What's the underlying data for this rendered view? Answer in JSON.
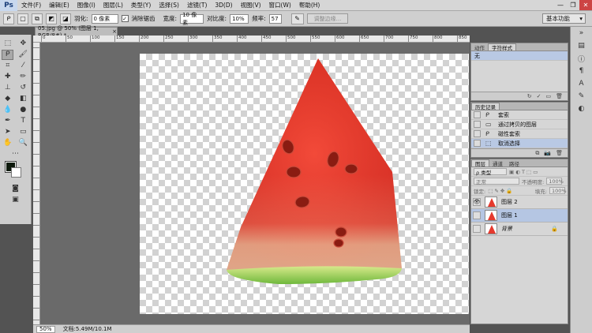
{
  "app": {
    "logo": "Ps"
  },
  "menu": [
    "文件(F)",
    "编辑(E)",
    "图像(I)",
    "图层(L)",
    "类型(Y)",
    "选择(S)",
    "滤镜(T)",
    "3D(D)",
    "视图(V)",
    "窗口(W)",
    "帮助(H)"
  ],
  "window_controls": {
    "minimize": "—",
    "restore": "❐",
    "close": "✕"
  },
  "options": {
    "feather_label": "羽化:",
    "feather_value": "0 像素",
    "antialias_label": "消除锯齿",
    "antialias_checked": "✓",
    "width_label": "宽度:",
    "width_value": "10 像素",
    "contrast_label": "对比度:",
    "contrast_value": "10%",
    "frequency_label": "频率:",
    "frequency_value": "57",
    "refine_label": "调整边缘...",
    "workspace": "基本功能"
  },
  "document": {
    "tab_title": "05.jpg @ 50% (图层 1, RGB/8#) *",
    "close": "×"
  },
  "ruler": {
    "top_ticks": [
      "0",
      "50",
      "100",
      "150",
      "200",
      "250",
      "300",
      "350",
      "400",
      "450",
      "500",
      "550",
      "600",
      "650",
      "700",
      "750",
      "800",
      "850"
    ]
  },
  "status": {
    "zoom": "50%",
    "doc_info": "文档:5.49M/10.1M"
  },
  "colors": {
    "foreground": "#0e1a0d",
    "background": "#ffffff",
    "selection": "#b5c6e3"
  },
  "actions_panel": {
    "tabs": [
      "动作",
      "字符样式"
    ],
    "active_item": "无"
  },
  "history_panel": {
    "title": "历史记录",
    "items": [
      {
        "label": "套索",
        "icon": "lasso-icon"
      },
      {
        "label": "通过拷贝的图层",
        "icon": "layer-icon"
      },
      {
        "label": "磁性套索",
        "icon": "magnetic-lasso-icon"
      },
      {
        "label": "取消选择",
        "icon": "deselect-icon"
      }
    ]
  },
  "layers_panel": {
    "tabs": [
      "图层",
      "通道",
      "路径"
    ],
    "filter_label": "ρ 类型",
    "blend_mode": "正常",
    "opacity_label": "不透明度:",
    "opacity_value": "100%",
    "lock_label": "锁定:",
    "fill_label": "填充:",
    "fill_value": "100%",
    "layers": [
      {
        "name": "图层 2",
        "visible": "👁"
      },
      {
        "name": "图层 1",
        "visible": ""
      },
      {
        "name": "背景",
        "visible": "",
        "lock": "🔒"
      }
    ]
  }
}
